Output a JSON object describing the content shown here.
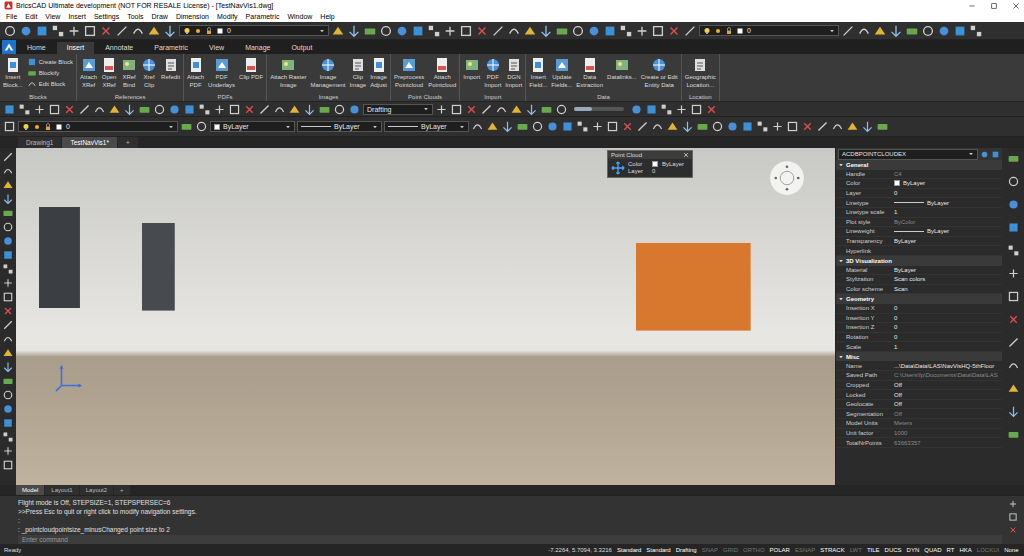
{
  "window": {
    "title": "BricsCAD Ultimate development (NOT FOR RESALE License) - [TestNavVis1.dwg]"
  },
  "menu": [
    "File",
    "Edit",
    "View",
    "Insert",
    "Settings",
    "Tools",
    "Draw",
    "Dimension",
    "Modify",
    "Parametric",
    "Window",
    "Help"
  ],
  "quick_access": {
    "layer_left": "0",
    "layer_right": "0"
  },
  "ribbon": {
    "tabs": [
      {
        "label": "Home",
        "selected": false
      },
      {
        "label": "Insert",
        "selected": true
      },
      {
        "label": "Annotate",
        "selected": false
      },
      {
        "label": "Parametric",
        "selected": false
      },
      {
        "label": "View",
        "selected": false
      },
      {
        "label": "Manage",
        "selected": false
      },
      {
        "label": "Output",
        "selected": false
      }
    ],
    "panels": [
      {
        "title": "Blocks",
        "buttons": [
          {
            "kind": "large",
            "lines": [
              "Insert",
              "Block..."
            ]
          },
          {
            "kind": "small",
            "lines": [
              "Create Block"
            ]
          },
          {
            "kind": "small",
            "lines": [
              "Blockify"
            ]
          },
          {
            "kind": "small",
            "lines": [
              "Edit Block"
            ]
          }
        ]
      },
      {
        "title": "References",
        "buttons": [
          {
            "kind": "large",
            "lines": [
              "Attach",
              "XRef"
            ]
          },
          {
            "kind": "large",
            "lines": [
              "Open",
              "XRef"
            ]
          },
          {
            "kind": "large",
            "lines": [
              "XRef",
              "Bind"
            ]
          },
          {
            "kind": "large",
            "lines": [
              "Xref",
              "Clip"
            ]
          },
          {
            "kind": "large",
            "lines": [
              "Refedit"
            ]
          }
        ]
      },
      {
        "title": "PDFs",
        "buttons": [
          {
            "kind": "large",
            "lines": [
              "Attach",
              "PDF"
            ]
          },
          {
            "kind": "large",
            "lines": [
              "PDF",
              "Underlays"
            ]
          },
          {
            "kind": "large",
            "lines": [
              "Clip PDF"
            ]
          }
        ]
      },
      {
        "title": "Images",
        "buttons": [
          {
            "kind": "large",
            "lines": [
              "Attach Raster",
              "Image"
            ]
          },
          {
            "kind": "large",
            "lines": [
              "Image",
              "Management"
            ]
          },
          {
            "kind": "large",
            "lines": [
              "Clip",
              "Image"
            ]
          },
          {
            "kind": "large",
            "lines": [
              "Image",
              "Adjust"
            ]
          }
        ]
      },
      {
        "title": "Point Clouds",
        "buttons": [
          {
            "kind": "large",
            "lines": [
              "Preprocess",
              "Pointcloud"
            ]
          },
          {
            "kind": "large",
            "lines": [
              "Attach",
              "Pointcloud"
            ]
          }
        ]
      },
      {
        "title": "Import",
        "buttons": [
          {
            "kind": "large",
            "lines": [
              "Import"
            ]
          },
          {
            "kind": "large",
            "lines": [
              "PDF",
              "Import"
            ]
          },
          {
            "kind": "large",
            "lines": [
              "DGN",
              "Import"
            ]
          }
        ]
      },
      {
        "title": "Data",
        "buttons": [
          {
            "kind": "large",
            "lines": [
              "Insert",
              "Field..."
            ]
          },
          {
            "kind": "large",
            "lines": [
              "Update",
              "Fields..."
            ]
          },
          {
            "kind": "large",
            "lines": [
              "Data",
              "Extraction"
            ]
          },
          {
            "kind": "large",
            "lines": [
              "Datalinks..."
            ]
          },
          {
            "kind": "large",
            "lines": [
              "Create or Edit",
              "Entity Data"
            ]
          }
        ]
      },
      {
        "title": "Location",
        "buttons": [
          {
            "kind": "large",
            "lines": [
              "Geographic",
              "Location..."
            ]
          }
        ]
      }
    ]
  },
  "toolbar1": {
    "workspace": "Drafting",
    "slider": {
      "level": 0.35
    }
  },
  "toolbar2": {
    "layer": "0",
    "color": "ByLayer",
    "linetype": "ByLayer",
    "lineweight": "ByLayer"
  },
  "doc_tabs": [
    {
      "label": "Drawing1",
      "selected": false
    },
    {
      "label": "TestNavVis1*",
      "selected": true
    },
    {
      "label": "+",
      "selected": false
    }
  ],
  "viewport": {
    "popup": {
      "title": "Point Cloud",
      "rows": [
        {
          "label": "Color",
          "value": "ByLayer",
          "kind": "color"
        },
        {
          "label": "Layer",
          "value": "0",
          "kind": "text"
        }
      ]
    }
  },
  "properties": {
    "object": "ACDBPOINTCLOUDEX",
    "sections": [
      {
        "title": "General",
        "expanded": true,
        "rows": [
          {
            "label": "Handle",
            "value": "C4",
            "kind": "text",
            "disabled": true
          },
          {
            "label": "Color",
            "value": "ByLayer",
            "kind": "color",
            "disabled": false
          },
          {
            "label": "Layer",
            "value": "0",
            "kind": "text",
            "disabled": false
          },
          {
            "label": "Linetype",
            "value": "ByLayer",
            "kind": "line",
            "disabled": false
          },
          {
            "label": "Linetype scale",
            "value": "1",
            "kind": "text",
            "disabled": false
          },
          {
            "label": "Plot style",
            "value": "ByColor",
            "kind": "text",
            "disabled": true
          },
          {
            "label": "Lineweight",
            "value": "ByLayer",
            "kind": "line",
            "disabled": false
          },
          {
            "label": "Transparency",
            "value": "ByLayer",
            "kind": "text",
            "disabled": false
          },
          {
            "label": "Hyperlink",
            "value": "",
            "kind": "text",
            "disabled": false
          }
        ]
      },
      {
        "title": "3D Visualization",
        "expanded": true,
        "rows": [
          {
            "label": "Material",
            "value": "ByLayer",
            "kind": "text",
            "disabled": false
          },
          {
            "label": "Stylization",
            "value": "Scan colors",
            "kind": "text",
            "disabled": false
          },
          {
            "label": "Color scheme",
            "value": "Scan",
            "kind": "text",
            "disabled": false
          }
        ]
      },
      {
        "title": "Geometry",
        "expanded": true,
        "rows": [
          {
            "label": "Insertion X",
            "value": "0",
            "kind": "text",
            "disabled": false
          },
          {
            "label": "Insertion Y",
            "value": "0",
            "kind": "text",
            "disabled": false
          },
          {
            "label": "Insertion Z",
            "value": "0",
            "kind": "text",
            "disabled": false
          },
          {
            "label": "Rotation",
            "value": "0",
            "kind": "text",
            "disabled": false
          },
          {
            "label": "Scale",
            "value": "1",
            "kind": "text",
            "disabled": false
          }
        ]
      },
      {
        "title": "Misc",
        "expanded": true,
        "rows": [
          {
            "label": "Name",
            "value": "...\\Data\\Data\\LAS\\NavVisHQ-5thFloor",
            "kind": "text",
            "disabled": false
          },
          {
            "label": "Saved Path",
            "value": "C:\\Users\\fp\\Documents\\Data\\Data\\LAS",
            "kind": "text",
            "disabled": true
          },
          {
            "label": "Cropped",
            "value": "Off",
            "kind": "text",
            "disabled": false
          },
          {
            "label": "Locked",
            "value": "Off",
            "kind": "text",
            "disabled": false
          },
          {
            "label": "Geolocate",
            "value": "Off",
            "kind": "text",
            "disabled": false
          },
          {
            "label": "Segmentation",
            "value": "Off",
            "kind": "text",
            "disabled": true
          },
          {
            "label": "Model Units",
            "value": "Meters",
            "kind": "text",
            "disabled": true
          },
          {
            "label": "Unit factor",
            "value": "1000",
            "kind": "text",
            "disabled": true
          },
          {
            "label": "TotalNrPoints",
            "value": "63663357",
            "kind": "text",
            "disabled": true
          }
        ]
      }
    ]
  },
  "layout_tabs": [
    {
      "label": "Model",
      "selected": true
    },
    {
      "label": "Layout1",
      "selected": false
    },
    {
      "label": "Layout2",
      "selected": false
    },
    {
      "label": "+",
      "selected": false
    }
  ],
  "command": {
    "history": [
      "Flight mode is Off, STEPSIZE=1, STEPSPERSEC=6",
      ">>Press Esc to quit or right click to modify navigation settings.",
      ":",
      ": _pointcloudpointsize_minusChanged point size to 2"
    ],
    "placeholder": "Enter command"
  },
  "status_bar": {
    "message": "Ready",
    "coordinates": "-7.2264, 5.7094, 3.3216",
    "items": [
      {
        "label": "Standard",
        "on": true
      },
      {
        "label": "Standard",
        "on": true
      },
      {
        "label": "Drafting",
        "on": true
      },
      {
        "label": "SNAP",
        "on": false
      },
      {
        "label": "GRID",
        "on": false
      },
      {
        "label": "ORTHO",
        "on": false
      },
      {
        "label": "POLAR",
        "on": true
      },
      {
        "label": "ESNAP",
        "on": false
      },
      {
        "label": "STRACK",
        "on": true
      },
      {
        "label": "LWT",
        "on": false
      },
      {
        "label": "TILE",
        "on": true
      },
      {
        "label": "DUCS",
        "on": true
      },
      {
        "label": "DYN",
        "on": true
      },
      {
        "label": "QUAD",
        "on": true
      },
      {
        "label": "RT",
        "on": true
      },
      {
        "label": "HKA",
        "on": true
      },
      {
        "label": "LOCKUI",
        "on": false
      },
      {
        "label": "None",
        "on": true
      }
    ]
  }
}
